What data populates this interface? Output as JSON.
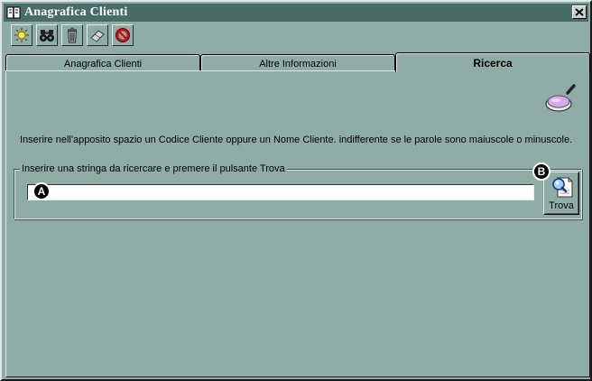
{
  "window": {
    "title": "Anagrafica Clienti"
  },
  "toolbar": {
    "buttons": [
      {
        "icon": "new-icon"
      },
      {
        "icon": "binoculars-icon"
      },
      {
        "icon": "trash-icon"
      },
      {
        "icon": "eraser-icon"
      },
      {
        "icon": "stop-icon"
      }
    ]
  },
  "tabs": [
    {
      "label": "Anagrafica Clienti",
      "active": false
    },
    {
      "label": "Altre Informazioni",
      "active": false
    },
    {
      "label": "Ricerca",
      "active": true
    }
  ],
  "search": {
    "description": "Inserire nell'apposito spazio un Codice Cliente oppure un Nome Cliente. indifferente se le parole sono maiuscole o minuscole.",
    "group_label": "Inserire una stringa da ricercare e premere il pulsante Trova",
    "input_value": "",
    "button_label": "Trova"
  },
  "markers": {
    "a": "A",
    "b": "B"
  },
  "colors": {
    "background": "#8fada6",
    "titlebar": "#496c67",
    "stop_red": "#cc1111"
  }
}
